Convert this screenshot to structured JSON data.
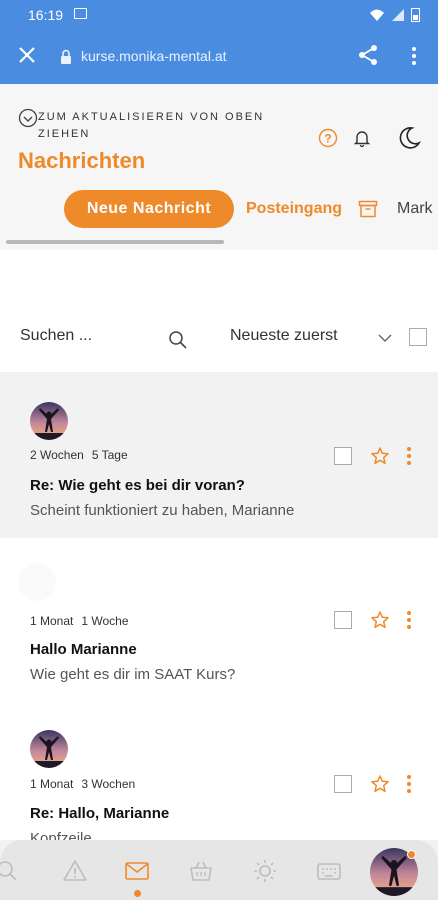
{
  "status_bar": {
    "time": "16:19"
  },
  "browser": {
    "url": "kurse.monika-mental.at"
  },
  "header": {
    "refresh_hint": "ZUM AKTUALISIEREN VON OBEN ZIEHEN",
    "title": "Nachrichten"
  },
  "tabs": {
    "new_message": "Neue Nachricht",
    "inbox": "Posteingang",
    "marked": "Mark"
  },
  "search": {
    "placeholder": "Suchen ...",
    "sort": "Neueste zuerst"
  },
  "messages": [
    {
      "age_1": "2 Wochen",
      "age_2": "5 Tage",
      "subject": "Re: Wie geht es bei dir voran?",
      "preview": "Scheint funktioniert zu haben, Marianne",
      "has_avatar": true
    },
    {
      "age_1": "1 Monat",
      "age_2": "1 Woche",
      "subject": "Hallo Marianne",
      "preview": "Wie geht es dir im SAAT Kurs?",
      "has_avatar": false
    },
    {
      "age_1": "1 Monat",
      "age_2": "3 Wochen",
      "subject": "Re: Hallo, Marianne",
      "preview": "Kopfzeile",
      "has_avatar": true
    }
  ],
  "colors": {
    "accent": "#ef8a2b",
    "browser_bar": "#4a8de0"
  },
  "bottom_nav": {
    "items": [
      "search-icon",
      "warning-icon",
      "mail-icon",
      "basket-icon",
      "sun-icon",
      "keyboard-icon",
      "avatar"
    ],
    "active": "mail-icon"
  }
}
